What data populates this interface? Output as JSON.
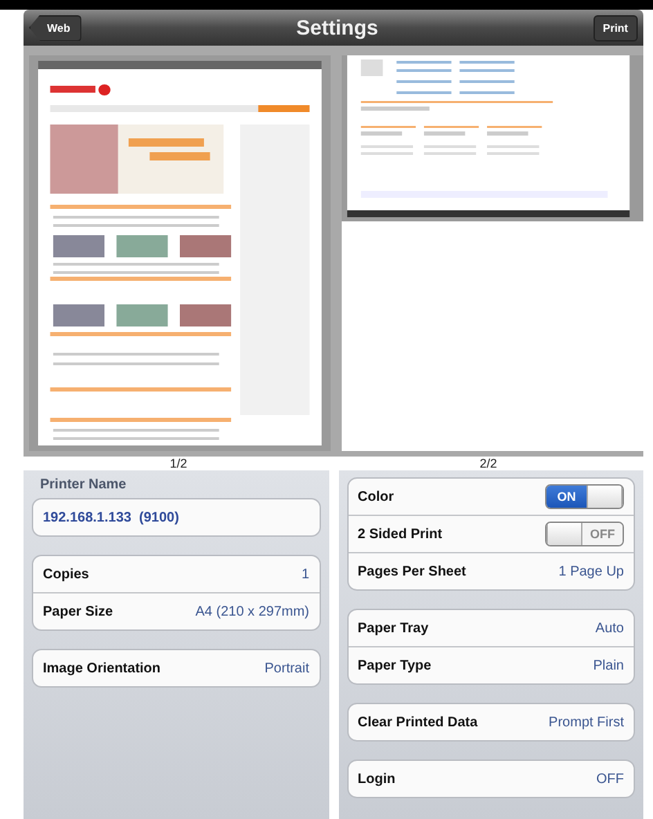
{
  "nav": {
    "back": "Web",
    "title": "Settings",
    "action": "Print"
  },
  "previews": [
    {
      "label": "1/2",
      "kind": "full"
    },
    {
      "label": "2/2",
      "kind": "partial"
    }
  ],
  "left": {
    "header": "Printer Name",
    "groups": [
      [
        {
          "kind": "address",
          "label": "192.168.1.133  (9100)"
        }
      ],
      [
        {
          "kind": "value",
          "label": "Copies",
          "value": "1"
        },
        {
          "kind": "value",
          "label": "Paper Size",
          "value": "A4 (210 x 297mm)"
        }
      ],
      [
        {
          "kind": "value",
          "label": "Image Orientation",
          "value": "Portrait"
        }
      ]
    ]
  },
  "right": {
    "groups": [
      [
        {
          "kind": "toggle",
          "label": "Color",
          "state_text": "ON",
          "on": true
        },
        {
          "kind": "toggle",
          "label": "2 Sided Print",
          "state_text": "OFF",
          "on": false
        },
        {
          "kind": "value",
          "label": "Pages Per Sheet",
          "value": "1 Page Up"
        }
      ],
      [
        {
          "kind": "value",
          "label": "Paper Tray",
          "value": "Auto"
        },
        {
          "kind": "value",
          "label": "Paper Type",
          "value": "Plain"
        }
      ],
      [
        {
          "kind": "value",
          "label": "Clear Printed Data",
          "value": "Prompt First"
        }
      ],
      [
        {
          "kind": "value",
          "label": "Login",
          "value": "OFF"
        }
      ]
    ]
  }
}
